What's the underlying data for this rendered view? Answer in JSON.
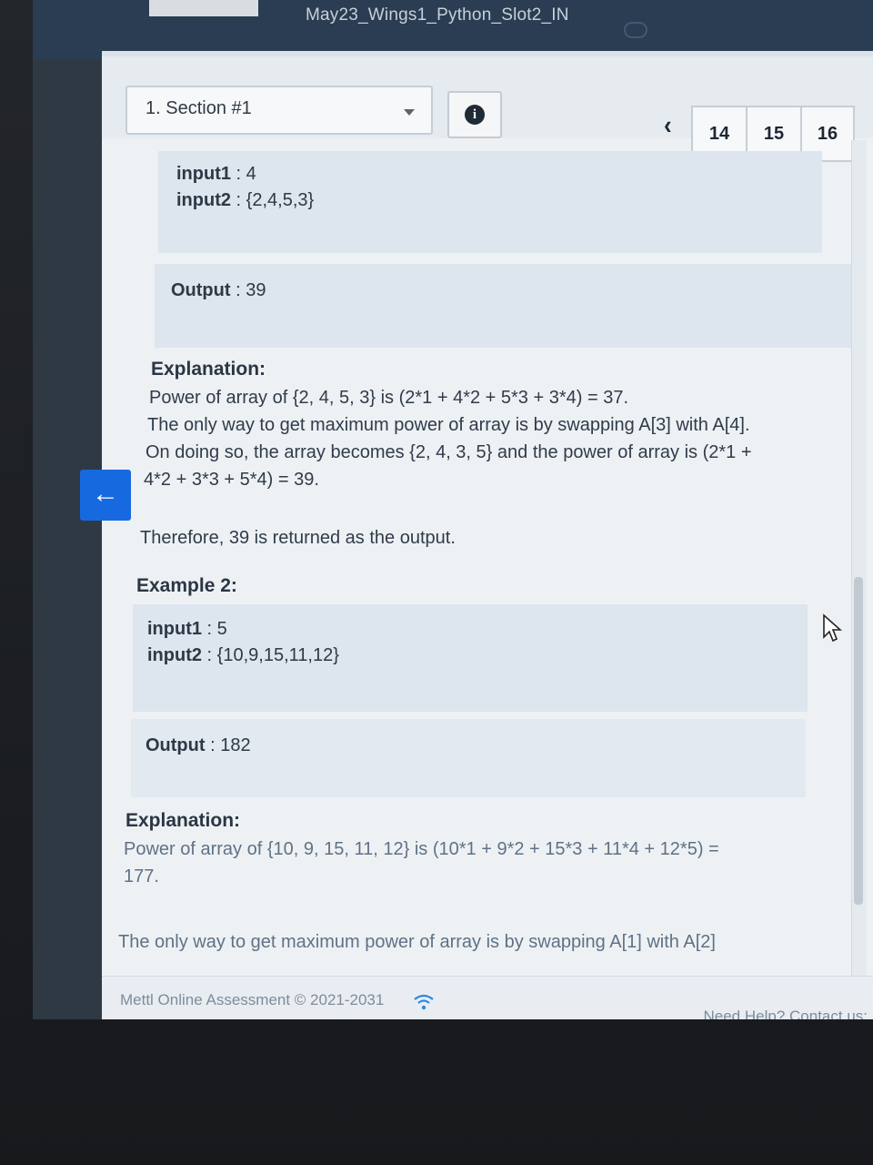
{
  "window": {
    "test_title": "May23_Wings1_Python_Slot2_IN",
    "top_right_text": ""
  },
  "toolbar": {
    "section_label": "1. Section #1",
    "question_tabs": [
      "14",
      "15",
      "16"
    ]
  },
  "example1": {
    "input1_key": "input1",
    "input1_value": " : 4",
    "input2_key": "input2",
    "input2_value": " : {2,4,5,3}",
    "output_key": "Output",
    "output_value": " : 39",
    "explanation_heading": "Explanation:",
    "explanation_lines": [
      "Power of array of {2, 4, 5, 3} is (2*1 + 4*2 + 5*3 + 3*4) = 37.",
      "The only way to get maximum power of array is by swapping A[3] with A[4].",
      "On doing so, the array becomes {2, 4, 3, 5} and the power of array is (2*1 +",
      "4*2 + 3*3 + 5*4) = 39."
    ],
    "conclusion": "Therefore, 39 is returned as the output."
  },
  "example2": {
    "heading": "Example 2:",
    "input1_key": "input1",
    "input1_value": " : 5",
    "input2_key": "input2",
    "input2_value": " : {10,9,15,11,12}",
    "output_key": "Output",
    "output_value": " : 182",
    "explanation_heading": "Explanation:",
    "explanation_lines": [
      "Power of array of {10, 9, 15, 11, 12} is (10*1 + 9*2 + 15*3 + 11*4 + 12*5) =",
      "177."
    ],
    "next_line": "The only way to get maximum power of array is by swapping A[1] with A[2]"
  },
  "footer": {
    "copyright": "Mettl Online Assessment © 2021-2031",
    "help": "Need Help? Contact us:"
  },
  "colors": {
    "accent": "#1769e0",
    "io_box": "#dde5ee",
    "panel": "#eef1f4"
  }
}
